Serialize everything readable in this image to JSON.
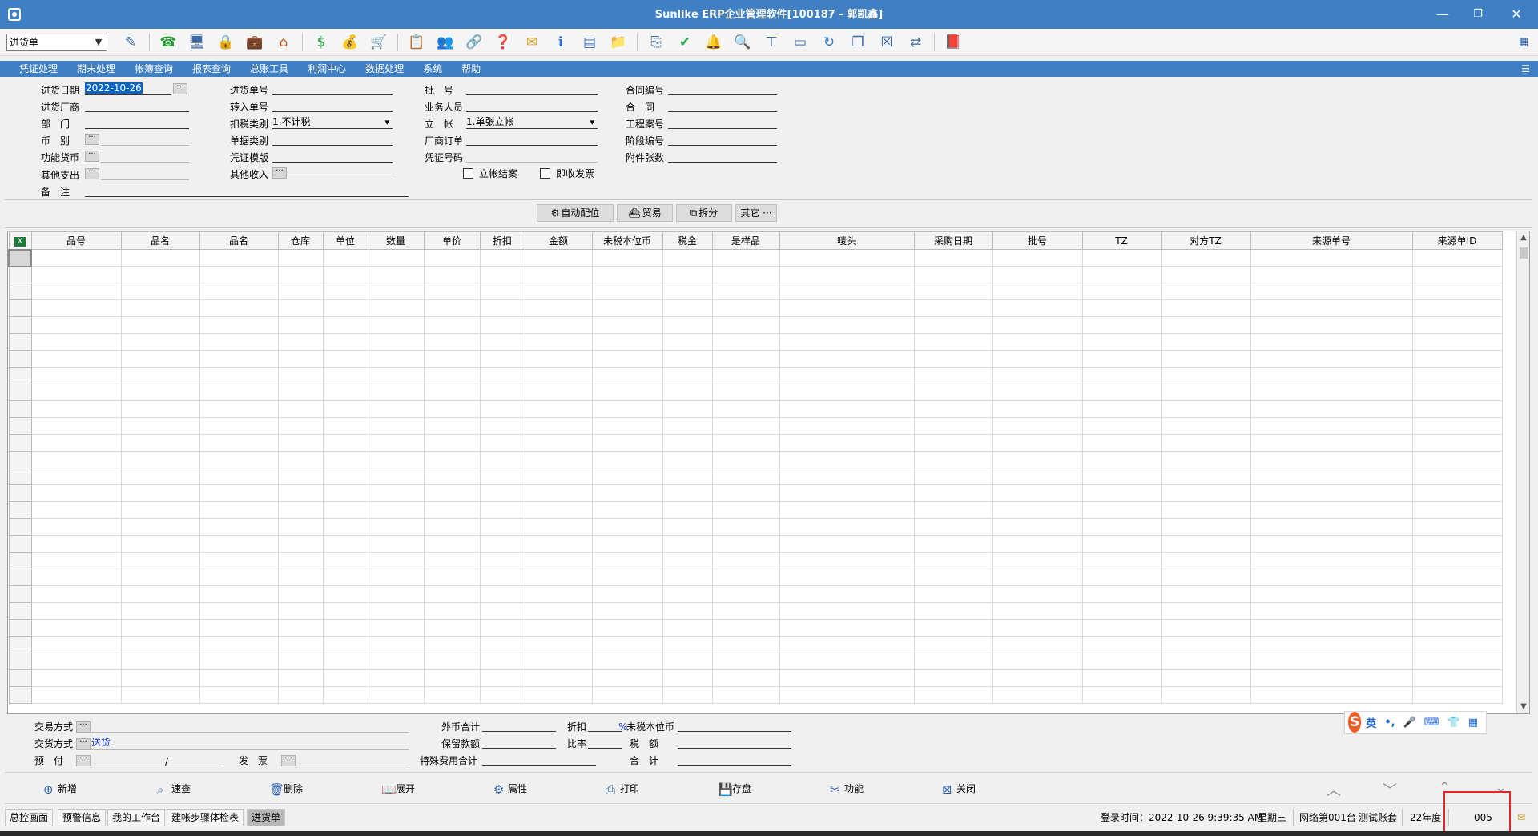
{
  "window": {
    "title": "Sunlike ERP企业管理软件[100187 - 郭凯鑫]",
    "buttons": {
      "minimize": "—",
      "restore": "❐",
      "close": "✕"
    }
  },
  "toolbar": {
    "doc_type": "进货单",
    "icons": [
      "spell-check-icon",
      "phone-icon",
      "computer-icon",
      "lock-icon",
      "briefcase-icon",
      "home-icon",
      "dollar-icon",
      "money-bag-icon",
      "cart-icon",
      "clipboard-icon",
      "users-icon",
      "link-icon",
      "help-doc-icon",
      "mail-icon",
      "info-icon",
      "calculator-icon",
      "folder-icon",
      "copy-icon",
      "check-icon",
      "bell-icon",
      "search-icon",
      "org-chart-icon",
      "monitor-icon",
      "refresh-icon",
      "windows-icon",
      "close-box-icon",
      "switch-icon",
      "book-icon"
    ]
  },
  "menu": [
    "凭证处理",
    "期末处理",
    "帐簿查询",
    "报表查询",
    "总账工具",
    "利润中心",
    "数据处理",
    "系统",
    "帮助"
  ],
  "form": {
    "date_label": "进货日期",
    "date_value": "2022-10-26",
    "vendor_label": "进货厂商",
    "dept_label": "部　门",
    "currency_label": "币　别",
    "func_currency_label": "功能货币",
    "other_expense_label": "其他支出",
    "remark_label": "备　注",
    "order_no_label": "进货单号",
    "transfer_no_label": "转入单号",
    "tax_type_label": "扣税类别",
    "tax_type_value": "1.不计税",
    "doc_category_label": "单据类别",
    "voucher_template_label": "凭证模版",
    "other_income_label": "其他收入",
    "batch_label": "批　号",
    "salesperson_label": "业务人员",
    "account_label": "立　帐",
    "account_value": "1.单张立帐",
    "vendor_order_label": "厂商订单",
    "voucher_no_label": "凭证号码",
    "close_account_label": "立帐结案",
    "instant_invoice_label": "即收发票",
    "contract_no_label": "合同编号",
    "contract_label": "合　同",
    "project_no_label": "工程案号",
    "stage_no_label": "阶段编号",
    "attachments_label": "附件张数"
  },
  "actions": {
    "auto_match": "自动配位",
    "trade": "贸易",
    "split": "拆分",
    "other": "其它 ···"
  },
  "grid": {
    "columns": [
      "品号",
      "品名",
      "品名",
      "仓库",
      "单位",
      "数量",
      "单价",
      "折扣",
      "金额",
      "未税本位币",
      "税金",
      "是样品",
      "唛头",
      "采购日期",
      "批号",
      "TZ",
      "对方TZ",
      "来源单号",
      "来源单ID"
    ],
    "visible_rows": 27
  },
  "summary": {
    "trade_method_label": "交易方式",
    "delivery_method_label": "交货方式",
    "delivery_method_value": "送货",
    "prepay_label": "预　付",
    "prepay_sep": "/",
    "invoice_label": "发　票",
    "foreign_total_label": "外币合计",
    "retention_label": "保留款额",
    "special_fee_label": "特殊费用合计",
    "discount_label": "折扣",
    "discount_symbol": "%",
    "ratio_label": "比率",
    "untaxed_label": "未税本位币",
    "tax_label": "税　额",
    "total_label": "合　计"
  },
  "ime": {
    "lang": "英",
    "items": [
      "•,",
      "🎤",
      "⌨",
      "👕",
      "▦"
    ]
  },
  "bottom_buttons": {
    "new": "新增",
    "quick_view": "速查",
    "delete": "删除",
    "expand": "展开",
    "properties": "属性",
    "print": "打印",
    "save": "存盘",
    "functions": "功能",
    "close": "关闭"
  },
  "status": {
    "tabs": [
      "总控画面",
      "预警信息",
      "我的工作台",
      "建帐步骤体检表",
      "进货单"
    ],
    "active_tab": 4,
    "login_time": "登录时间：2022-10-26 9:39:35 AM",
    "weekday": "星期三",
    "network_user": "网络第001台",
    "account_set": "测试账套",
    "year": "22年度",
    "code": "005"
  }
}
